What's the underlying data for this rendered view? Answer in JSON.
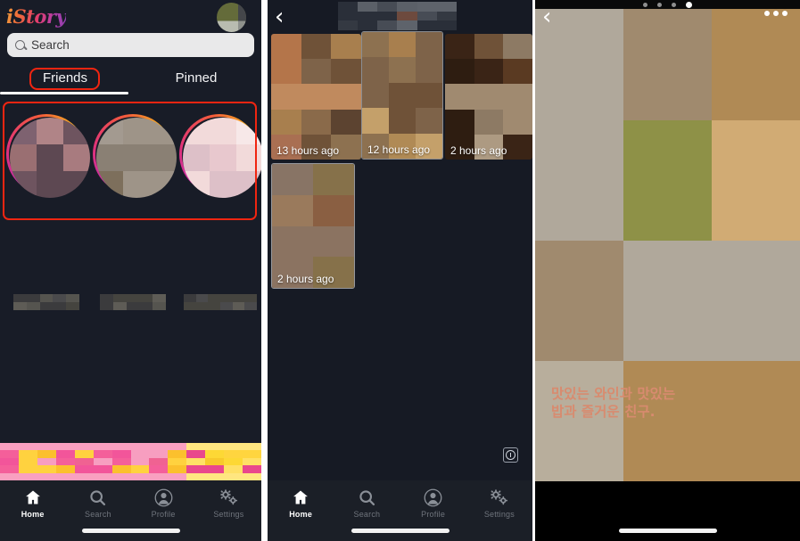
{
  "app": {
    "logo": "iStory",
    "background": "#181c27",
    "accent": "#f02511"
  },
  "panel1": {
    "name": "friends-story-feed",
    "search": {
      "placeholder": "Search",
      "value": "",
      "icon": "search-icon"
    },
    "avatar": {
      "icon": "avatar"
    },
    "tabs": [
      {
        "label": "Friends",
        "active": true,
        "annotated": true
      },
      {
        "label": "Pinned",
        "active": false,
        "annotated": false
      }
    ],
    "stories": [
      {
        "name": "story-1",
        "caption": "",
        "ring": "gradient"
      },
      {
        "name": "story-2",
        "caption": "",
        "ring": "gradient"
      },
      {
        "name": "story-3",
        "caption": "",
        "ring": "gradient"
      }
    ],
    "banner_ad": {
      "name": "banner-ad",
      "blurred": true
    },
    "nav": [
      {
        "label": "Home",
        "icon": "home-icon",
        "active": true
      },
      {
        "label": "Search",
        "icon": "search-icon",
        "active": false
      },
      {
        "label": "Profile",
        "icon": "profile-icon",
        "active": false
      },
      {
        "label": "Settings",
        "icon": "settings-gear-icon",
        "active": false
      }
    ]
  },
  "panel2": {
    "name": "story-list-grid",
    "back": "‹",
    "title_blurred": true,
    "cards": [
      {
        "name": "story-card-1",
        "ago": "13 hours ago"
      },
      {
        "name": "story-card-2",
        "ago": "12 hours ago"
      },
      {
        "name": "story-card-3",
        "ago": "2 hours ago"
      },
      {
        "name": "story-card-4",
        "ago": "2 hours ago"
      }
    ],
    "info_icon": "info-icon",
    "nav": [
      {
        "label": "Home",
        "icon": "home-icon",
        "active": true
      },
      {
        "label": "Search",
        "icon": "search-icon",
        "active": false
      },
      {
        "label": "Profile",
        "icon": "profile-icon",
        "active": false
      },
      {
        "label": "Settings",
        "icon": "settings-gear-icon",
        "active": false
      }
    ]
  },
  "panel3": {
    "name": "story-viewer",
    "back": "‹",
    "menu_icon": "kebab-menu-icon",
    "page_dots": {
      "total": 4,
      "active_index": 3
    },
    "caption_line1": "맛있는 와인과 맛있는",
    "caption_line2": "밥과 즐거운 친구.",
    "caption_color": "#d88b6f",
    "background": "#fbd7ab"
  }
}
